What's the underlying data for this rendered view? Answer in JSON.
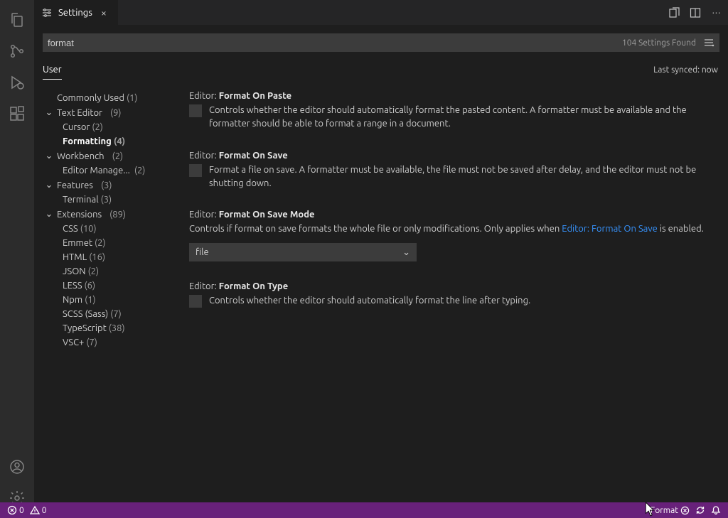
{
  "tab": {
    "title": "Settings"
  },
  "search": {
    "value": "format",
    "count_text": "104 Settings Found"
  },
  "scope": {
    "user": "User",
    "sync": "Last synced: now"
  },
  "toc": {
    "commonly_used": {
      "label": "Commonly Used",
      "count": "(1)"
    },
    "text_editor": {
      "label": "Text Editor",
      "count": "(9)"
    },
    "cursor": {
      "label": "Cursor",
      "count": "(2)"
    },
    "formatting": {
      "label": "Formatting",
      "count": "(4)"
    },
    "workbench": {
      "label": "Workbench",
      "count": "(2)"
    },
    "editor_mgmt": {
      "label": "Editor Manage...",
      "count": "(2)"
    },
    "features": {
      "label": "Features",
      "count": "(3)"
    },
    "terminal": {
      "label": "Terminal",
      "count": "(3)"
    },
    "extensions": {
      "label": "Extensions",
      "count": "(89)"
    },
    "css": {
      "label": "CSS",
      "count": "(10)"
    },
    "emmet": {
      "label": "Emmet",
      "count": "(2)"
    },
    "html": {
      "label": "HTML",
      "count": "(16)"
    },
    "json": {
      "label": "JSON",
      "count": "(2)"
    },
    "less": {
      "label": "LESS",
      "count": "(6)"
    },
    "npm": {
      "label": "Npm",
      "count": "(1)"
    },
    "scss": {
      "label": "SCSS (Sass)",
      "count": "(7)"
    },
    "ts": {
      "label": "TypeScript",
      "count": "(38)"
    },
    "vscplus": {
      "label": "VSC+",
      "count": "(7)"
    }
  },
  "settings": {
    "fop": {
      "scope": "Editor:",
      "name": "Format On Paste",
      "desc": "Controls whether the editor should automatically format the pasted content. A formatter must be available and the formatter should be able to format a range in a document."
    },
    "fos": {
      "scope": "Editor:",
      "name": "Format On Save",
      "desc": "Format a file on save. A formatter must be available, the file must not be saved after delay, and the editor must not be shutting down."
    },
    "fosm": {
      "scope": "Editor:",
      "name": "Format On Save Mode",
      "desc_pre": "Controls if format on save formats the whole file or only modifications. Only applies when ",
      "desc_link": "Editor: Format On Save",
      "desc_post": " is enabled.",
      "value": "file"
    },
    "fot": {
      "scope": "Editor:",
      "name": "Format On Type",
      "desc": "Controls whether the editor should automatically format the line after typing."
    }
  },
  "status": {
    "errors": "0",
    "warnings": "0",
    "format_item": "Format"
  }
}
